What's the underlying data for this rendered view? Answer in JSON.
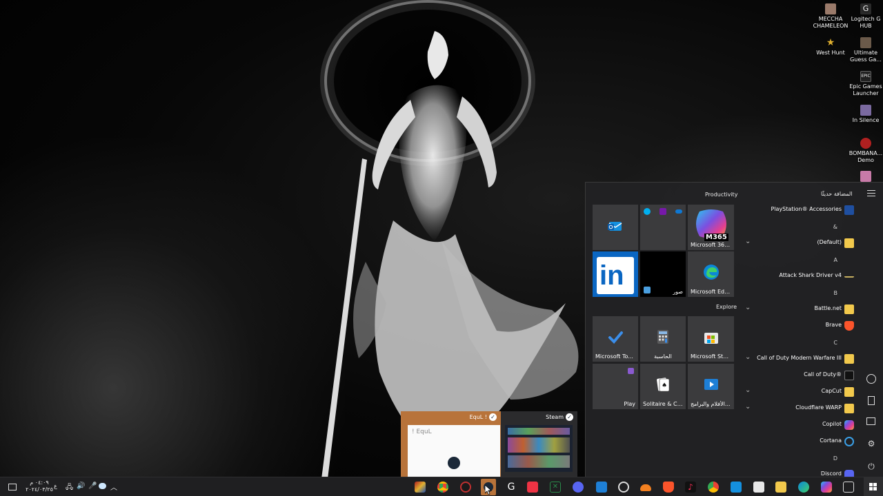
{
  "desktop": {
    "icons": [
      {
        "label": "MECCHA CHAMELEON",
        "icon": "game-icon",
        "color": "#9a7a6a"
      },
      {
        "label": "Logitech G HUB",
        "icon": "logitech-icon",
        "color": "#2a2a2a"
      },
      {
        "label": "West Hunt",
        "icon": "star-icon",
        "color": "#e0b030"
      },
      {
        "label": "Ultimate Guess Ga...",
        "icon": "game-icon",
        "color": "#6b5a4a"
      },
      {
        "label": "Epic Games Launcher",
        "icon": "epic-icon",
        "color": "#222"
      },
      {
        "label": "In Silence",
        "icon": "game-icon",
        "color": "#7b6aa0"
      },
      {
        "label": "BOMBANA... Demo",
        "icon": "game-icon",
        "color": "#b02020"
      }
    ]
  },
  "start_menu": {
    "groups": [
      {
        "title": "Productivity"
      },
      {
        "title": "Explore"
      }
    ],
    "tiles": [
      {
        "label": "",
        "icon": "outlook-icon"
      },
      {
        "label": "",
        "icon": "office-apps-icon"
      },
      {
        "label": "Microsoft 365...",
        "icon": "m365-icon",
        "badge": "M365"
      },
      {
        "label": "",
        "icon": "linkedin-icon"
      },
      {
        "label": "صور",
        "icon": "photos-icon"
      },
      {
        "label": "Microsoft Edge",
        "icon": "edge-icon"
      },
      {
        "label": "Microsoft To...",
        "icon": "todo-icon"
      },
      {
        "label": "الحاسبة",
        "icon": "calculator-icon"
      },
      {
        "label": "Microsoft Store",
        "icon": "store-icon"
      },
      {
        "label": "Play",
        "icon": "play-icon"
      },
      {
        "label": "Solitaire & Ca...",
        "icon": "solitaire-icon"
      },
      {
        "label": "الأفلام والبرامج...",
        "icon": "movies-icon"
      }
    ],
    "header_recent": "المضافة حديثًا",
    "app_list": [
      {
        "label": "PlayStation® Accessories",
        "icon": "playstation-icon",
        "chevron": false
      },
      {
        "letter": "&"
      },
      {
        "label": "(Default)",
        "icon": "folder-icon",
        "chevron": true
      },
      {
        "letter": "A"
      },
      {
        "label": "Attack Shark Driver v4",
        "icon": "driver-icon",
        "chevron": false
      },
      {
        "letter": "B"
      },
      {
        "label": "Battle.net",
        "icon": "folder-icon",
        "chevron": true
      },
      {
        "label": "Brave",
        "icon": "brave-icon",
        "chevron": false
      },
      {
        "letter": "C"
      },
      {
        "label": "Call of Duty Modern Warfare III",
        "icon": "folder-icon",
        "chevron": true
      },
      {
        "label": "Call of Duty®",
        "icon": "cod-icon",
        "chevron": false
      },
      {
        "label": "CapCut",
        "icon": "folder-icon",
        "chevron": true
      },
      {
        "label": "Cloudflare WARP",
        "icon": "folder-icon",
        "chevron": true
      },
      {
        "label": "Copilot",
        "icon": "copilot-icon",
        "chevron": false
      },
      {
        "label": "Cortana",
        "icon": "cortana-icon",
        "chevron": false
      },
      {
        "letter": "D"
      },
      {
        "label": "Discord",
        "icon": "discord-icon",
        "chevron": false
      }
    ]
  },
  "thumbnails": [
    {
      "title": "EquL !",
      "preview_text": "! EquL"
    },
    {
      "title": "Steam",
      "preview_text": ""
    }
  ],
  "tray": {
    "time": "٠٤:٠٩ م",
    "date": "٢٠٢٤/٠٣/٢٥",
    "lang": "ع"
  },
  "colors": {
    "accent_orange": "#b8733a",
    "tile_bg": "#3b3b3d",
    "folder": "#f2c94c",
    "linkedin": "#0a66c2"
  }
}
